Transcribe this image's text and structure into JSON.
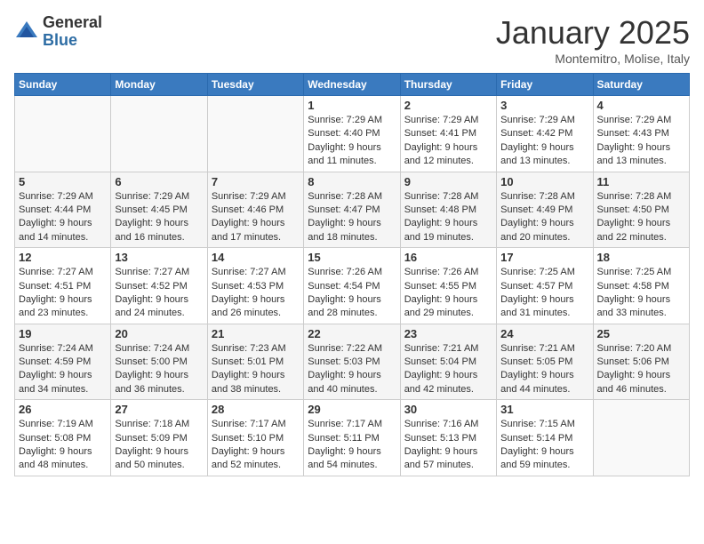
{
  "logo": {
    "general": "General",
    "blue": "Blue"
  },
  "title": "January 2025",
  "subtitle": "Montemitro, Molise, Italy",
  "days_header": [
    "Sunday",
    "Monday",
    "Tuesday",
    "Wednesday",
    "Thursday",
    "Friday",
    "Saturday"
  ],
  "weeks": [
    [
      {
        "day": "",
        "info": ""
      },
      {
        "day": "",
        "info": ""
      },
      {
        "day": "",
        "info": ""
      },
      {
        "day": "1",
        "info": "Sunrise: 7:29 AM\nSunset: 4:40 PM\nDaylight: 9 hours\nand 11 minutes."
      },
      {
        "day": "2",
        "info": "Sunrise: 7:29 AM\nSunset: 4:41 PM\nDaylight: 9 hours\nand 12 minutes."
      },
      {
        "day": "3",
        "info": "Sunrise: 7:29 AM\nSunset: 4:42 PM\nDaylight: 9 hours\nand 13 minutes."
      },
      {
        "day": "4",
        "info": "Sunrise: 7:29 AM\nSunset: 4:43 PM\nDaylight: 9 hours\nand 13 minutes."
      }
    ],
    [
      {
        "day": "5",
        "info": "Sunrise: 7:29 AM\nSunset: 4:44 PM\nDaylight: 9 hours\nand 14 minutes."
      },
      {
        "day": "6",
        "info": "Sunrise: 7:29 AM\nSunset: 4:45 PM\nDaylight: 9 hours\nand 16 minutes."
      },
      {
        "day": "7",
        "info": "Sunrise: 7:29 AM\nSunset: 4:46 PM\nDaylight: 9 hours\nand 17 minutes."
      },
      {
        "day": "8",
        "info": "Sunrise: 7:28 AM\nSunset: 4:47 PM\nDaylight: 9 hours\nand 18 minutes."
      },
      {
        "day": "9",
        "info": "Sunrise: 7:28 AM\nSunset: 4:48 PM\nDaylight: 9 hours\nand 19 minutes."
      },
      {
        "day": "10",
        "info": "Sunrise: 7:28 AM\nSunset: 4:49 PM\nDaylight: 9 hours\nand 20 minutes."
      },
      {
        "day": "11",
        "info": "Sunrise: 7:28 AM\nSunset: 4:50 PM\nDaylight: 9 hours\nand 22 minutes."
      }
    ],
    [
      {
        "day": "12",
        "info": "Sunrise: 7:27 AM\nSunset: 4:51 PM\nDaylight: 9 hours\nand 23 minutes."
      },
      {
        "day": "13",
        "info": "Sunrise: 7:27 AM\nSunset: 4:52 PM\nDaylight: 9 hours\nand 24 minutes."
      },
      {
        "day": "14",
        "info": "Sunrise: 7:27 AM\nSunset: 4:53 PM\nDaylight: 9 hours\nand 26 minutes."
      },
      {
        "day": "15",
        "info": "Sunrise: 7:26 AM\nSunset: 4:54 PM\nDaylight: 9 hours\nand 28 minutes."
      },
      {
        "day": "16",
        "info": "Sunrise: 7:26 AM\nSunset: 4:55 PM\nDaylight: 9 hours\nand 29 minutes."
      },
      {
        "day": "17",
        "info": "Sunrise: 7:25 AM\nSunset: 4:57 PM\nDaylight: 9 hours\nand 31 minutes."
      },
      {
        "day": "18",
        "info": "Sunrise: 7:25 AM\nSunset: 4:58 PM\nDaylight: 9 hours\nand 33 minutes."
      }
    ],
    [
      {
        "day": "19",
        "info": "Sunrise: 7:24 AM\nSunset: 4:59 PM\nDaylight: 9 hours\nand 34 minutes."
      },
      {
        "day": "20",
        "info": "Sunrise: 7:24 AM\nSunset: 5:00 PM\nDaylight: 9 hours\nand 36 minutes."
      },
      {
        "day": "21",
        "info": "Sunrise: 7:23 AM\nSunset: 5:01 PM\nDaylight: 9 hours\nand 38 minutes."
      },
      {
        "day": "22",
        "info": "Sunrise: 7:22 AM\nSunset: 5:03 PM\nDaylight: 9 hours\nand 40 minutes."
      },
      {
        "day": "23",
        "info": "Sunrise: 7:21 AM\nSunset: 5:04 PM\nDaylight: 9 hours\nand 42 minutes."
      },
      {
        "day": "24",
        "info": "Sunrise: 7:21 AM\nSunset: 5:05 PM\nDaylight: 9 hours\nand 44 minutes."
      },
      {
        "day": "25",
        "info": "Sunrise: 7:20 AM\nSunset: 5:06 PM\nDaylight: 9 hours\nand 46 minutes."
      }
    ],
    [
      {
        "day": "26",
        "info": "Sunrise: 7:19 AM\nSunset: 5:08 PM\nDaylight: 9 hours\nand 48 minutes."
      },
      {
        "day": "27",
        "info": "Sunrise: 7:18 AM\nSunset: 5:09 PM\nDaylight: 9 hours\nand 50 minutes."
      },
      {
        "day": "28",
        "info": "Sunrise: 7:17 AM\nSunset: 5:10 PM\nDaylight: 9 hours\nand 52 minutes."
      },
      {
        "day": "29",
        "info": "Sunrise: 7:17 AM\nSunset: 5:11 PM\nDaylight: 9 hours\nand 54 minutes."
      },
      {
        "day": "30",
        "info": "Sunrise: 7:16 AM\nSunset: 5:13 PM\nDaylight: 9 hours\nand 57 minutes."
      },
      {
        "day": "31",
        "info": "Sunrise: 7:15 AM\nSunset: 5:14 PM\nDaylight: 9 hours\nand 59 minutes."
      },
      {
        "day": "",
        "info": ""
      }
    ]
  ]
}
